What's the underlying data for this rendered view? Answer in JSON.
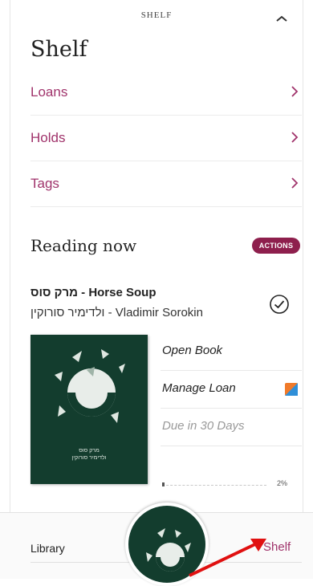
{
  "header": {
    "label": "SHELF"
  },
  "shelf": {
    "title": "Shelf",
    "items": [
      {
        "label": "Loans"
      },
      {
        "label": "Holds"
      },
      {
        "label": "Tags"
      }
    ]
  },
  "reading_now": {
    "title": "Reading now",
    "actions_label": "ACTIONS",
    "book": {
      "title": "מרק סוס - Horse Soup",
      "author": "ולדימיר סורוקין - Vladimir Sorokin",
      "cover_text": [
        "מרק סוס",
        "ולדימיר סורוקין"
      ],
      "actions": [
        "Open Book",
        "Manage Loan"
      ],
      "due": "Due in 30 Days",
      "progress": 0.02,
      "progress_label": "2%"
    }
  },
  "bottom_nav": {
    "left": "Library",
    "right": "Shelf"
  },
  "colors": {
    "accent": "#a0336b",
    "actions_bg": "#8e1f4d",
    "cover_bg": "#133d2e",
    "arrow": "#e01010"
  }
}
